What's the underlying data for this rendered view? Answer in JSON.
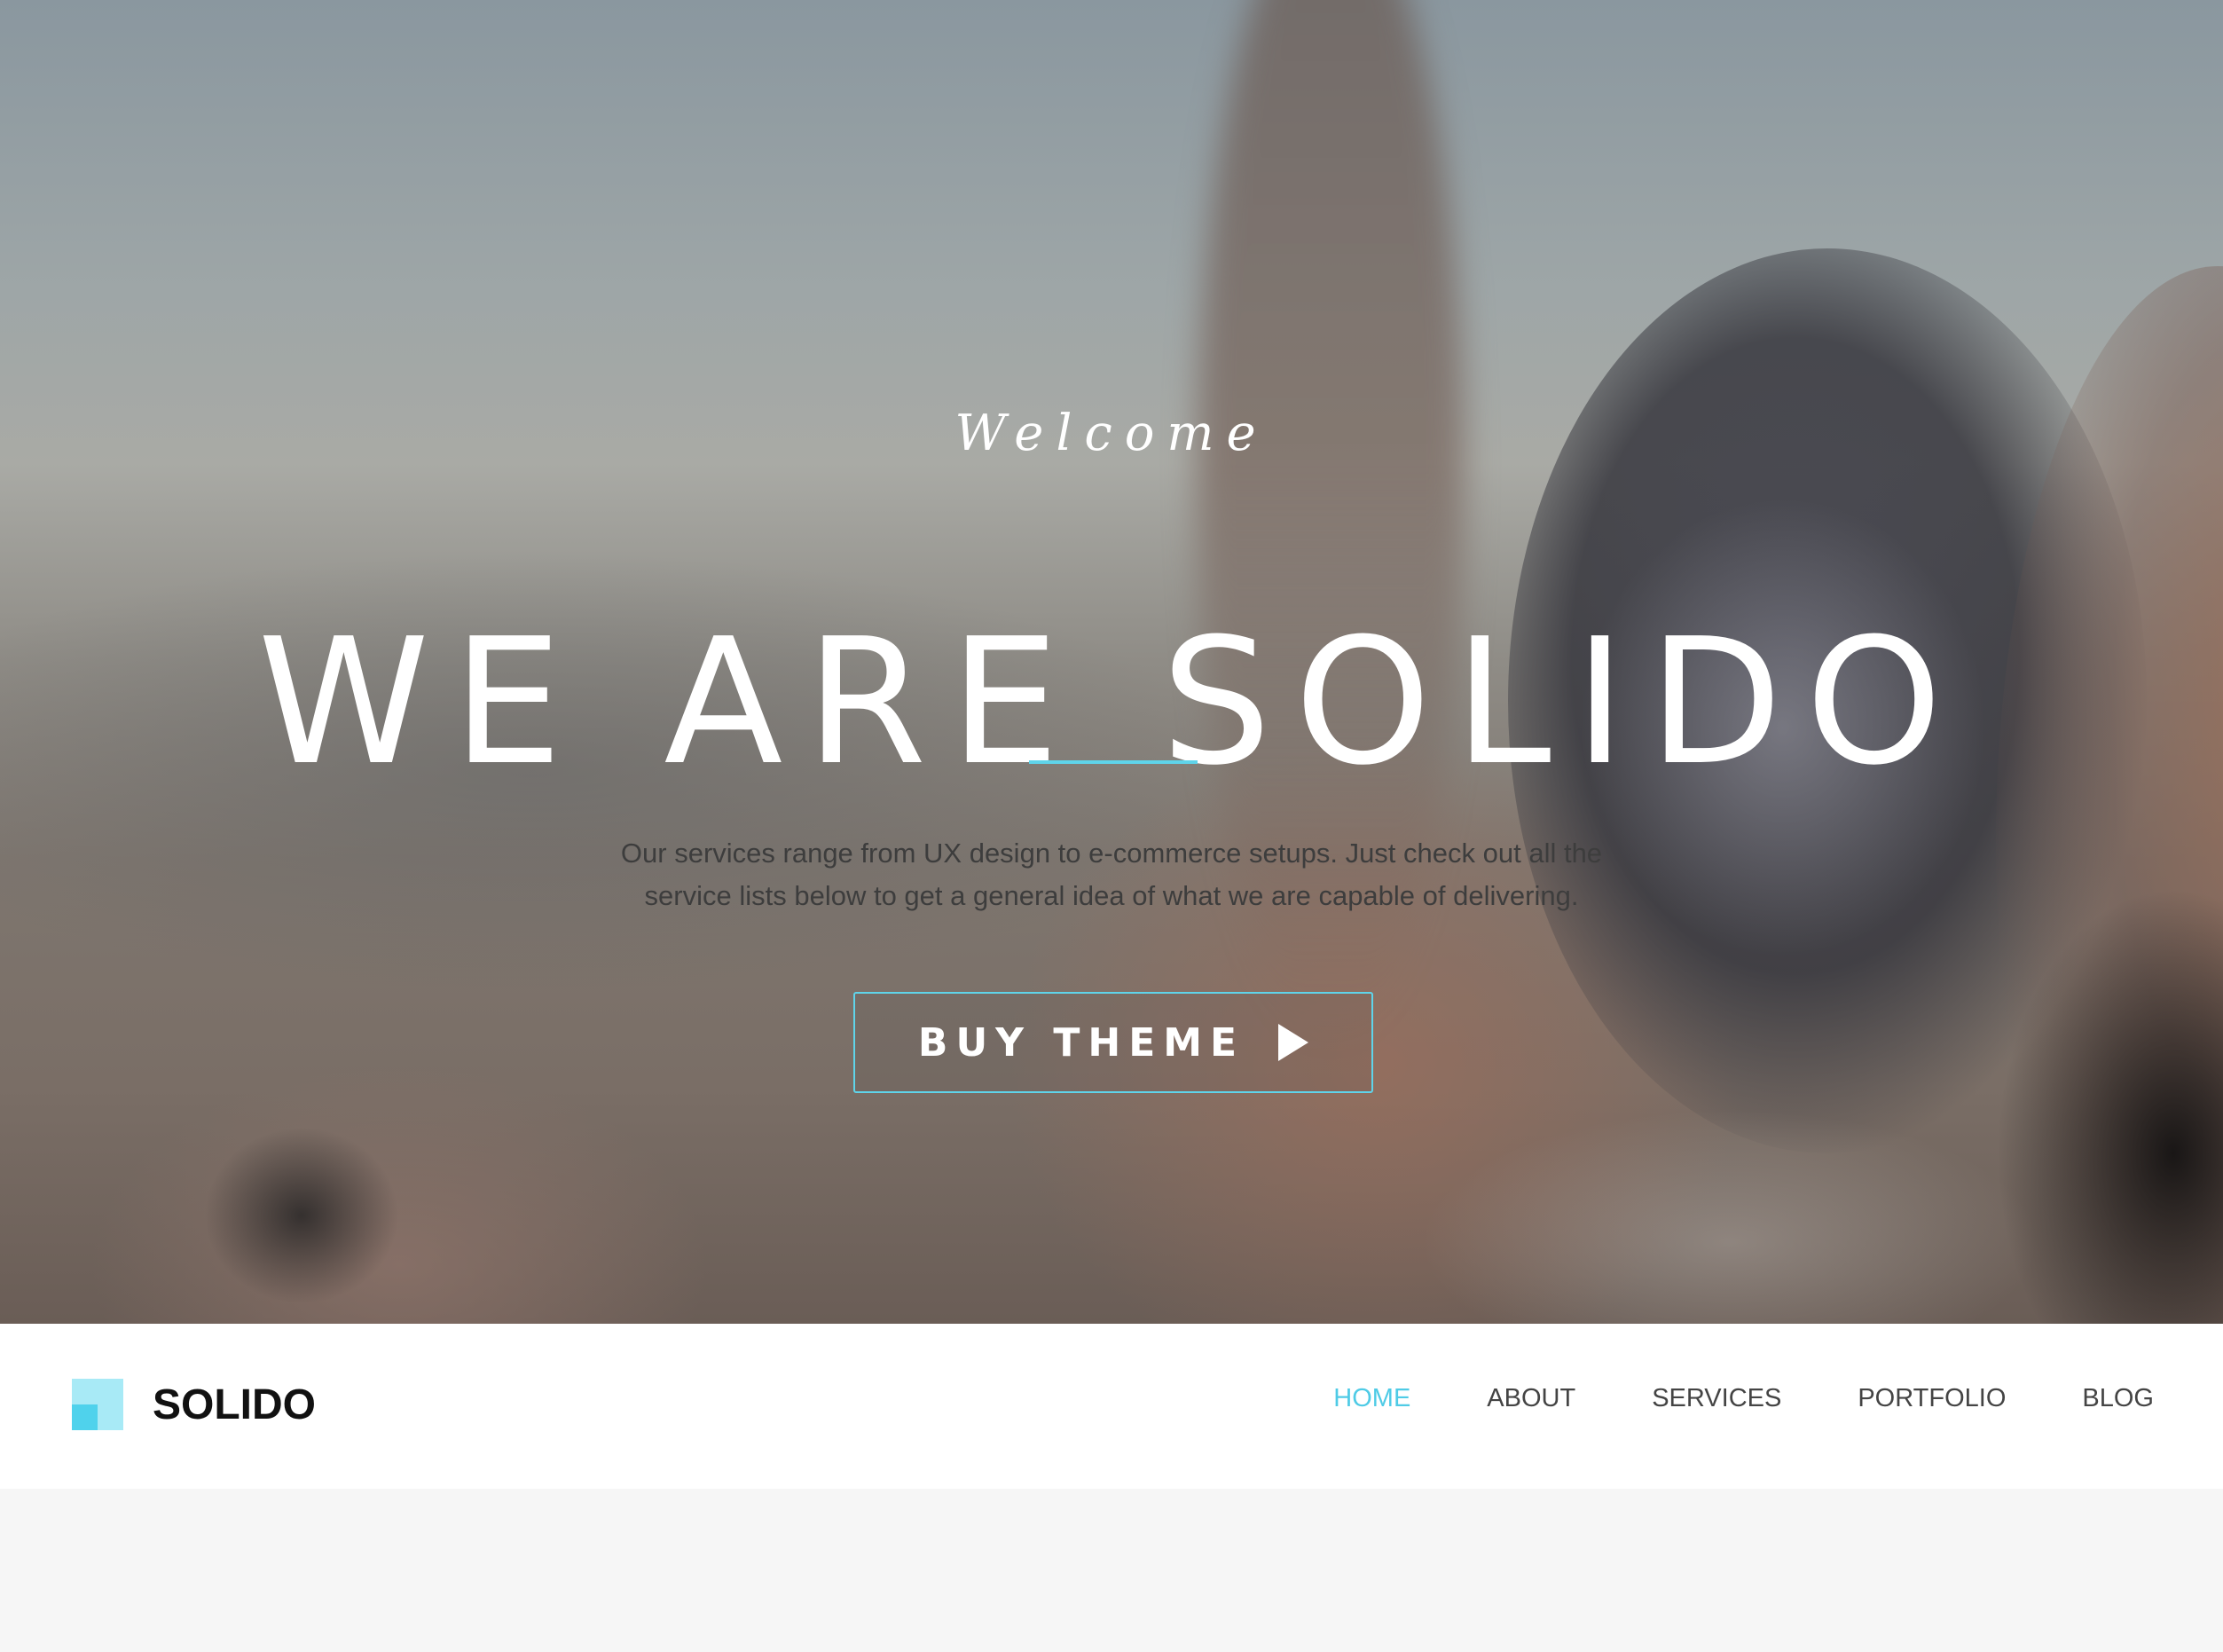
{
  "hero": {
    "welcome": "Welcome",
    "headline": "WE ARE SOLIDO",
    "lead_line1": "Our services range from UX design to e-commerce setups. Just check out all the",
    "lead_line2": "service lists below to get a general idea of what we are capable of delivering.",
    "cta_label": "BUY THEME",
    "cta_icon": "play-icon"
  },
  "brand": {
    "name": "SOLIDO",
    "logo_icon": "solido-logo-icon"
  },
  "nav": {
    "items": [
      {
        "label": "HOME",
        "active": true
      },
      {
        "label": "ABOUT",
        "active": false
      },
      {
        "label": "SERVICES",
        "active": false
      },
      {
        "label": "PORTFOLIO",
        "active": false
      },
      {
        "label": "BLOG",
        "active": false
      }
    ]
  },
  "colors": {
    "accent": "#4fcbe6",
    "logo_light": "#a8eaf6",
    "logo_dark": "#4fd2ec",
    "nav_text": "#444444",
    "page_background": "#f6f6f6"
  }
}
